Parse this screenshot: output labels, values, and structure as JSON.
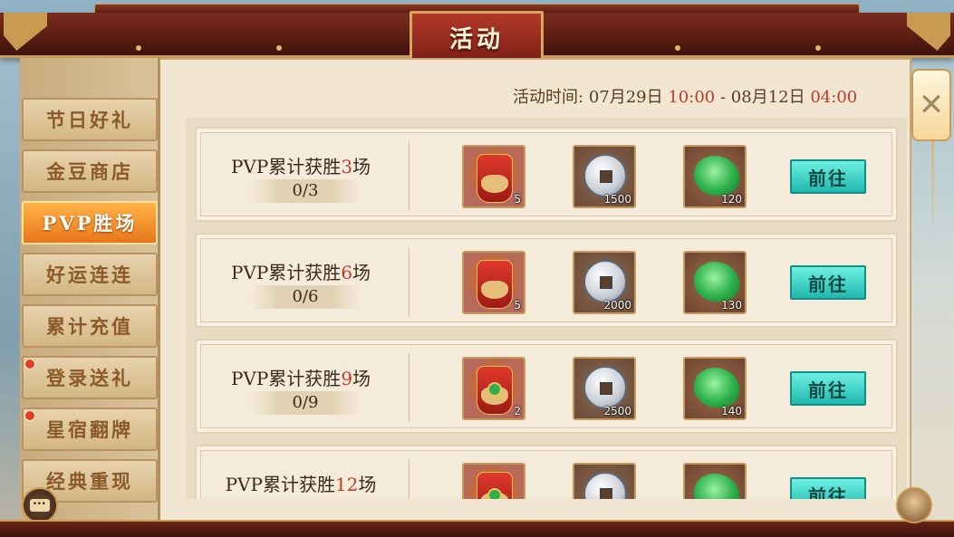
{
  "header": {
    "title": "活动"
  },
  "time": {
    "label": "活动时间:",
    "start_date": "07月29日",
    "start_time": "10:00",
    "separator": "-",
    "end_date": "08月12日",
    "end_time": "04:00"
  },
  "sidebar": {
    "items": [
      {
        "label": "节日好礼",
        "active": false,
        "dot": false
      },
      {
        "label": "金豆商店",
        "active": false,
        "dot": false
      },
      {
        "label": "PVP胜场",
        "active": true,
        "dot": false
      },
      {
        "label": "好运连连",
        "active": false,
        "dot": false
      },
      {
        "label": "累计充值",
        "active": false,
        "dot": false
      },
      {
        "label": "登录送礼",
        "active": false,
        "dot": true
      },
      {
        "label": "星宿翻牌",
        "active": false,
        "dot": true
      },
      {
        "label": "经典重现",
        "active": false,
        "dot": false
      }
    ]
  },
  "rewards": [
    {
      "title_prefix": "PVP累计获胜",
      "count": "3",
      "title_suffix": "场",
      "progress": "0/3",
      "items": [
        {
          "icon": "red-bag-icon",
          "qty": "5"
        },
        {
          "icon": "silver-coin-icon",
          "qty": "1500"
        },
        {
          "icon": "green-jade-icon",
          "qty": "120"
        }
      ],
      "button": "前往"
    },
    {
      "title_prefix": "PVP累计获胜",
      "count": "6",
      "title_suffix": "场",
      "progress": "0/6",
      "items": [
        {
          "icon": "red-bag-icon",
          "qty": "5"
        },
        {
          "icon": "silver-coin-icon",
          "qty": "2000"
        },
        {
          "icon": "green-jade-icon",
          "qty": "130"
        }
      ],
      "button": "前往"
    },
    {
      "title_prefix": "PVP累计获胜",
      "count": "9",
      "title_suffix": "场",
      "progress": "0/9",
      "items": [
        {
          "icon": "jade-bag-icon",
          "qty": "2"
        },
        {
          "icon": "silver-coin-icon",
          "qty": "2500"
        },
        {
          "icon": "green-jade-icon",
          "qty": "140"
        }
      ],
      "button": "前往"
    },
    {
      "title_prefix": "PVP累计获胜",
      "count": "12",
      "title_suffix": "场",
      "progress": "",
      "items": [
        {
          "icon": "jade-bag-icon",
          "qty": ""
        },
        {
          "icon": "silver-coin-icon",
          "qty": ""
        },
        {
          "icon": "green-jade-icon",
          "qty": ""
        }
      ],
      "button": "前往"
    }
  ],
  "colors": {
    "accent_red": "#c23a2a",
    "go_button": "#20b8ae",
    "active_tab": "#e8761c"
  }
}
